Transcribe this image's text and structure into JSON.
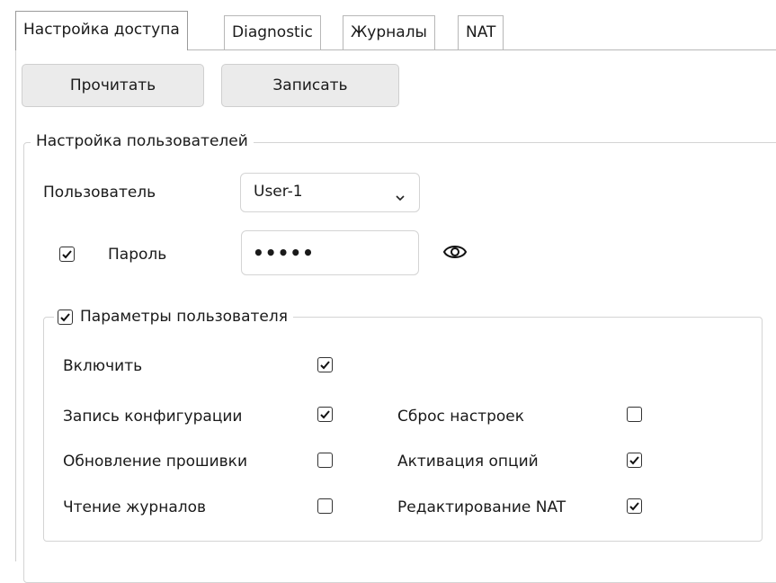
{
  "tabs": [
    {
      "label": "Настройка доступа",
      "active": true
    },
    {
      "label": "Diagnostic",
      "active": false
    },
    {
      "label": "Журналы",
      "active": false
    },
    {
      "label": "NAT",
      "active": false
    }
  ],
  "buttons": {
    "read": "Прочитать",
    "write": "Записать"
  },
  "users_group": {
    "title": "Настройка пользователей",
    "user_label": "Пользователь",
    "user_value": "User-1",
    "password_label": "Пароль",
    "password_checked": true,
    "password_value": "•••••",
    "show_password_icon": "eye-icon"
  },
  "params_group": {
    "title": "Параметры пользователя",
    "checked": true,
    "options": [
      {
        "label": "Включить",
        "checked": true
      },
      {
        "label": "Запись конфигурации",
        "checked": true
      },
      {
        "label": "Сброс настроек",
        "checked": false
      },
      {
        "label": "Обновление прошивки",
        "checked": false
      },
      {
        "label": "Активация опций",
        "checked": true
      },
      {
        "label": "Чтение журналов",
        "checked": false
      },
      {
        "label": "Редактирование NAT",
        "checked": true
      }
    ]
  }
}
